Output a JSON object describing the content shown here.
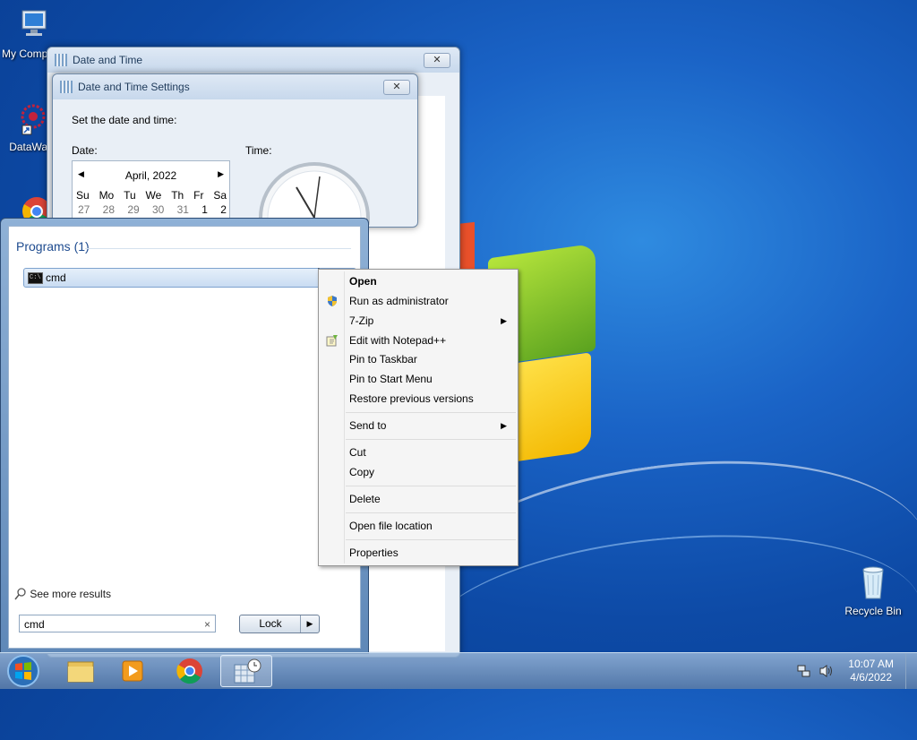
{
  "desktop": {
    "icons": [
      {
        "label": "My Comp"
      },
      {
        "label": "DataWag"
      },
      {
        "label": "Recycle Bin"
      }
    ]
  },
  "date_time_window": {
    "title": "Date and Time",
    "close": "✕"
  },
  "date_time_settings": {
    "title": "Date and Time Settings",
    "close": "✕",
    "instruction": "Set the date and time:",
    "date_label": "Date:",
    "time_label": "Time:",
    "calendar": {
      "month": "April, 2022",
      "prev": "◀",
      "next": "▶",
      "weekdays": [
        "Su",
        "Mo",
        "Tu",
        "We",
        "Th",
        "Fr",
        "Sa"
      ],
      "first_row": [
        "27",
        "28",
        "29",
        "30",
        "31",
        "1",
        "2"
      ]
    }
  },
  "start_menu": {
    "programs_heading": "Programs (1)",
    "program_item": "cmd",
    "see_more": "See more results",
    "search_value": "cmd",
    "search_clear": "×",
    "power_button": "Lock",
    "power_arrow": "▶"
  },
  "context_menu": {
    "items": [
      {
        "label": "Open"
      },
      {
        "label": "Run as administrator"
      },
      {
        "label": "7-Zip"
      },
      {
        "label": "Edit with Notepad++"
      },
      {
        "label": "Pin to Taskbar"
      },
      {
        "label": "Pin to Start Menu"
      },
      {
        "label": "Restore previous versions"
      },
      {
        "label": "Send to"
      },
      {
        "label": "Cut"
      },
      {
        "label": "Copy"
      },
      {
        "label": "Delete"
      },
      {
        "label": "Open file location"
      },
      {
        "label": "Properties"
      }
    ],
    "submenu_arrow": "▶"
  },
  "taskbar": {
    "time": "10:07 AM",
    "date": "4/6/2022"
  }
}
